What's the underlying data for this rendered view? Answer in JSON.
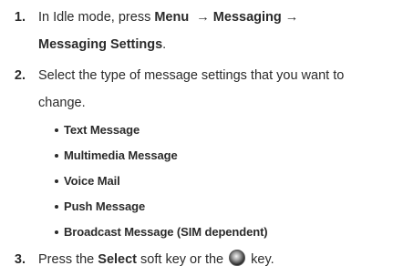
{
  "steps": [
    {
      "number": "1.",
      "line1_prefix": "In Idle mode, press ",
      "line1_menu": "Menu",
      "arrow1": "→",
      "line1_messaging": "Messaging",
      "arrow2": "→",
      "line2_bold": "Messaging Settings",
      "line2_suffix": "."
    },
    {
      "number": "2.",
      "line1": "Select the type of message settings that you want to",
      "line2": "change."
    },
    {
      "number": "3.",
      "prefix": "Press the ",
      "select": "Select",
      "middle": " soft key or the ",
      "icon": "navigation-key-icon",
      "suffix": " key."
    }
  ],
  "bullets": [
    "Text Message",
    "Multimedia Message",
    "Voice Mail",
    "Push Message",
    "Broadcast Message (SIM dependent)"
  ]
}
